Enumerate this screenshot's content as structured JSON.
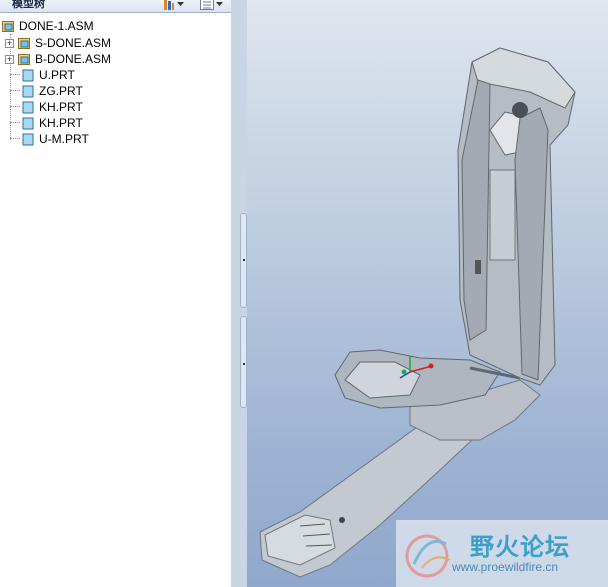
{
  "model_tree": {
    "title": "模型树",
    "toolbar": {
      "show_icon": "tree-filter-icon",
      "settings_icon": "settings-list-icon"
    },
    "root": {
      "label": "DONE-1.ASM",
      "icon": "assembly-icon"
    },
    "items": [
      {
        "label": "S-DONE.ASM",
        "icon": "assembly-icon",
        "expandable": true
      },
      {
        "label": "B-DONE.ASM",
        "icon": "assembly-icon",
        "expandable": true
      },
      {
        "label": "U.PRT",
        "icon": "part-icon",
        "expandable": false
      },
      {
        "label": "ZG.PRT",
        "icon": "part-icon",
        "expandable": false
      },
      {
        "label": "KH.PRT",
        "icon": "part-icon",
        "expandable": false
      },
      {
        "label": "KH.PRT",
        "icon": "part-icon",
        "expandable": false
      },
      {
        "label": "U-M.PRT",
        "icon": "part-icon",
        "expandable": false
      }
    ]
  },
  "viewport": {
    "background_top": "#dfe6ef",
    "background_bottom": "#90a8cc",
    "model_color": "#c9ced4"
  },
  "watermark": {
    "title": "野火论坛",
    "url": "www.proewildfire.cn"
  }
}
